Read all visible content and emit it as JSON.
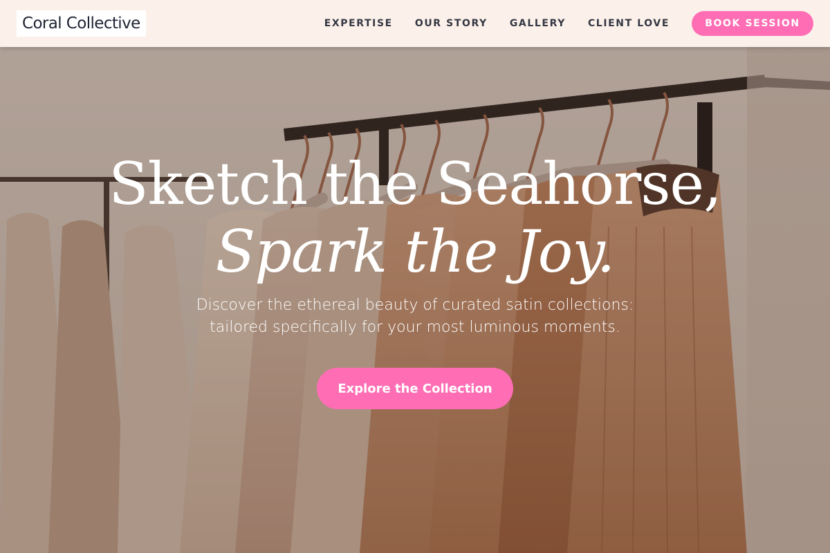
{
  "header": {
    "logo": "Coral Collective",
    "nav": [
      {
        "label": "EXPERTISE"
      },
      {
        "label": "OUR STORY"
      },
      {
        "label": "GALLERY"
      },
      {
        "label": "CLIENT LOVE"
      }
    ],
    "cta_label": "BOOK SESSION"
  },
  "hero": {
    "title_line1": "Sketch the Seahorse,",
    "title_line2": "Spark the Joy.",
    "subtitle_line1": "Discover the ethereal beauty of curated satin collections:",
    "subtitle_line2": "tailored specifically for your most luminous moments.",
    "cta_label": "Explore the Collection"
  },
  "colors": {
    "accent": "#ff6eb4",
    "header_bg": "#fcf1ea",
    "logo_text": "#1f2433",
    "nav_text": "#343743"
  },
  "icons": [
    "clothing-rack-photo"
  ]
}
